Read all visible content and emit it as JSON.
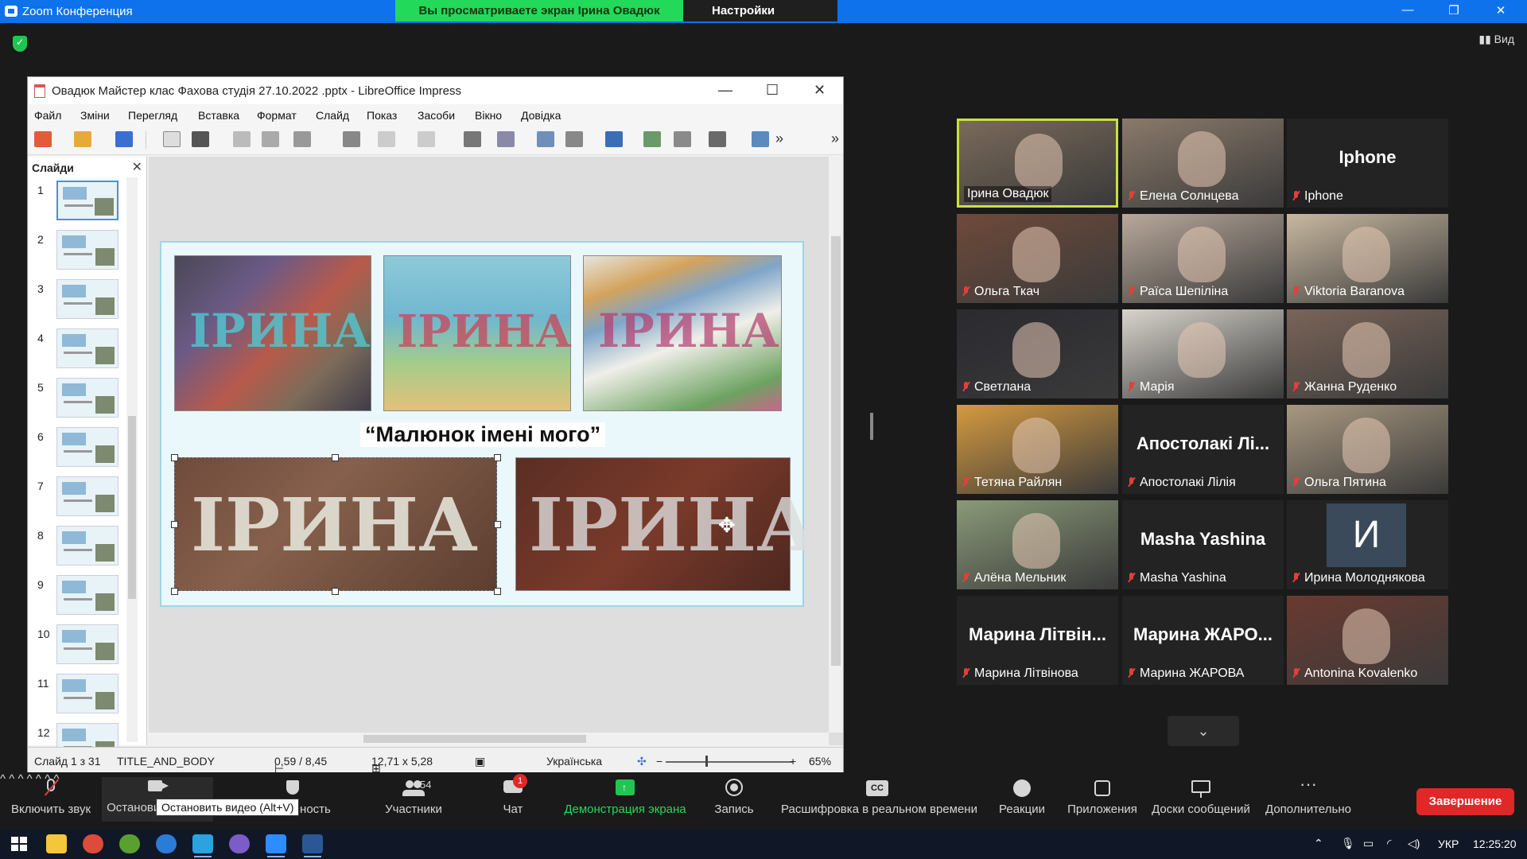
{
  "zoom": {
    "app_title": "Zoom Конференция",
    "share_banner": "Вы просматриваете экран Ірина Овадюк",
    "view_options": "Настройки просмотра",
    "view_button": "Вид",
    "window_controls": [
      "—",
      "❐",
      "✕"
    ]
  },
  "libreoffice": {
    "title": "Овадюк Майстер клас Фахова студія 27.10.2022  .pptx - LibreOffice Impress",
    "window_controls": [
      "—",
      "☐",
      "✕"
    ],
    "menu": [
      "Файл",
      "Зміни",
      "Перегляд",
      "Вставка",
      "Формат",
      "Слайд",
      "Показ",
      "Засоби",
      "Вікно",
      "Довідка"
    ],
    "slides_panel_title": "Слайди",
    "slide_numbers": [
      "1",
      "2",
      "3",
      "4",
      "5",
      "6",
      "7",
      "8",
      "9",
      "10",
      "11",
      "12"
    ],
    "slide_caption": "“Малюнок імені мого”",
    "photo_letters": [
      "ІРИНА",
      "ІРИНА",
      "ІРИНА",
      "ІРИНА",
      "ІРИНА"
    ],
    "status": {
      "slide": "Слайд 1 з 31",
      "layout": "TITLE_AND_BODY",
      "position": "0,59 / 8,45",
      "size": "12,71 x 5,28",
      "language": "Українська",
      "zoom": "65%"
    }
  },
  "participants": [
    {
      "name": "Ірина Овадюк",
      "muted": false,
      "active": true,
      "video": true,
      "tone": "#7a6a5a"
    },
    {
      "name": "Елена Солнцева",
      "muted": true,
      "active": false,
      "video": true,
      "tone": "#8a7a6a"
    },
    {
      "name": "Iphone",
      "muted": true,
      "active": false,
      "video": false,
      "big": "Iphone"
    },
    {
      "name": "Ольга Ткач",
      "muted": true,
      "active": false,
      "video": true,
      "tone": "#6f4a3a"
    },
    {
      "name": "Раїса Шепіліна",
      "muted": true,
      "active": false,
      "video": true,
      "tone": "#b8a89a"
    },
    {
      "name": "Viktoria Baranova",
      "muted": true,
      "active": false,
      "video": true,
      "tone": "#c8b8a0"
    },
    {
      "name": "Светлана",
      "muted": true,
      "active": false,
      "video": true,
      "tone": "#2a2a30"
    },
    {
      "name": "Марія",
      "muted": true,
      "active": false,
      "video": true,
      "tone": "#d8d4cc"
    },
    {
      "name": "Жанна Руденко",
      "muted": true,
      "active": false,
      "video": true,
      "tone": "#7a6458"
    },
    {
      "name": "Тетяна Райлян",
      "muted": true,
      "active": false,
      "video": true,
      "tone": "#d49a40"
    },
    {
      "name": "Апостолакі Лілія",
      "muted": true,
      "active": false,
      "video": false,
      "big": "Апостолакі Лі..."
    },
    {
      "name": "Ольга Пятина",
      "muted": true,
      "active": false,
      "video": true,
      "tone": "#a89880"
    },
    {
      "name": "Алёна Мельник",
      "muted": true,
      "active": false,
      "video": true,
      "tone": "#8a9a78"
    },
    {
      "name": "Masha Yashina",
      "muted": true,
      "active": false,
      "video": false,
      "big": "Masha Yashina"
    },
    {
      "name": "Ирина Молоднякова",
      "muted": true,
      "active": false,
      "video": false,
      "initial": "И"
    },
    {
      "name": "Марина Літвінова",
      "muted": true,
      "active": false,
      "video": false,
      "big": "Марина Літвін..."
    },
    {
      "name": "Марина ЖАРОВА",
      "muted": true,
      "active": false,
      "video": false,
      "big": "Марина ЖАРО..."
    },
    {
      "name": "Antonina Kovalenko",
      "muted": true,
      "active": false,
      "video": true,
      "tone": "#6a3a30"
    }
  ],
  "toolbar": {
    "unmute": "Включить звук",
    "stop_video": "Остановить видео",
    "security": "Безопасность",
    "participants": "Участники",
    "participants_count": "54",
    "chat": "Чат",
    "chat_badge": "1",
    "share_screen": "Демонстрация экрана",
    "record": "Запись",
    "live_transcript": "Расшифровка в реальном времени",
    "reactions": "Реакции",
    "apps": "Приложения",
    "whiteboards": "Доски сообщений",
    "more": "Дополнительно",
    "end": "Завершение",
    "tooltip": "Остановить видео (Alt+V)"
  },
  "taskbar": {
    "language": "УКР",
    "time": "12:25:20"
  },
  "colors": {
    "zoom_blue": "#0e72ed",
    "share_green": "#23d959",
    "end_red": "#e02828",
    "active_speaker": "#c8e23a"
  }
}
